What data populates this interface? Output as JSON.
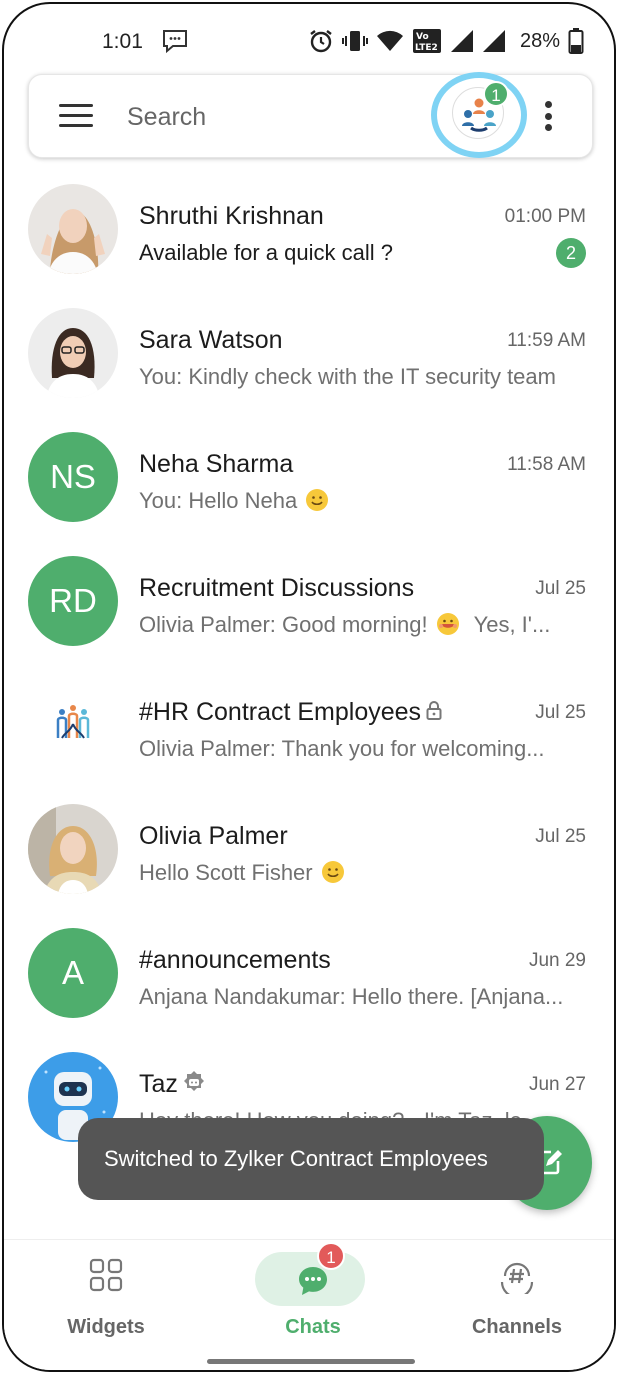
{
  "status_bar": {
    "time": "1:01",
    "battery": "28%",
    "icons": [
      "chat-notification-icon",
      "alarm-icon",
      "vibrate-icon",
      "wifi-icon",
      "volte-icon",
      "signal-icon",
      "signal-icon",
      "battery-icon"
    ],
    "volte_label": "VoLTE2"
  },
  "header": {
    "search_label": "Search",
    "org_badge": "1"
  },
  "chats": [
    {
      "name": "Shruthi Krishnan",
      "time": "01:00 PM",
      "preview": "Available for a quick call ?",
      "unread": "2",
      "avatar": "photo"
    },
    {
      "name": "Sara Watson",
      "time": "11:59 AM",
      "preview": "You: Kindly check with the IT security team",
      "avatar": "photo"
    },
    {
      "name": "Neha Sharma",
      "time": "11:58 AM",
      "preview": "You: Hello Neha",
      "avatar_initials": "NS"
    },
    {
      "name": "Recruitment Discussions",
      "time": "Jul 25",
      "preview": "Olivia Palmer: Good morning!",
      "preview_extra": "Yes, I'...",
      "avatar_initials": "RD"
    },
    {
      "name": "#HR Contract Employees",
      "time": "Jul 25",
      "preview": "Olivia Palmer: Thank you for welcoming...",
      "avatar": "logo"
    },
    {
      "name": "Olivia Palmer",
      "time": "Jul 25",
      "preview": "Hello Scott Fisher",
      "avatar": "photo"
    },
    {
      "name": "#announcements",
      "time": "Jun 29",
      "preview": "Anjana Nandakumar: Hello there. [Anjana...",
      "avatar_initials": "A"
    },
    {
      "name": "Taz",
      "time": "Jun 27",
      "preview": "Hey there! How you doing? - I'm Taz, le...",
      "avatar": "bot"
    }
  ],
  "toast": {
    "text": "Switched to Zylker Contract Employees"
  },
  "bottom_nav": {
    "widgets": "Widgets",
    "chats": "Chats",
    "chats_badge": "1",
    "channels": "Channels"
  },
  "colors": {
    "accent": "#4fae6d",
    "badge_red": "#e25a5a",
    "ring": "#7fd3f4",
    "toast_bg": "#555555"
  }
}
